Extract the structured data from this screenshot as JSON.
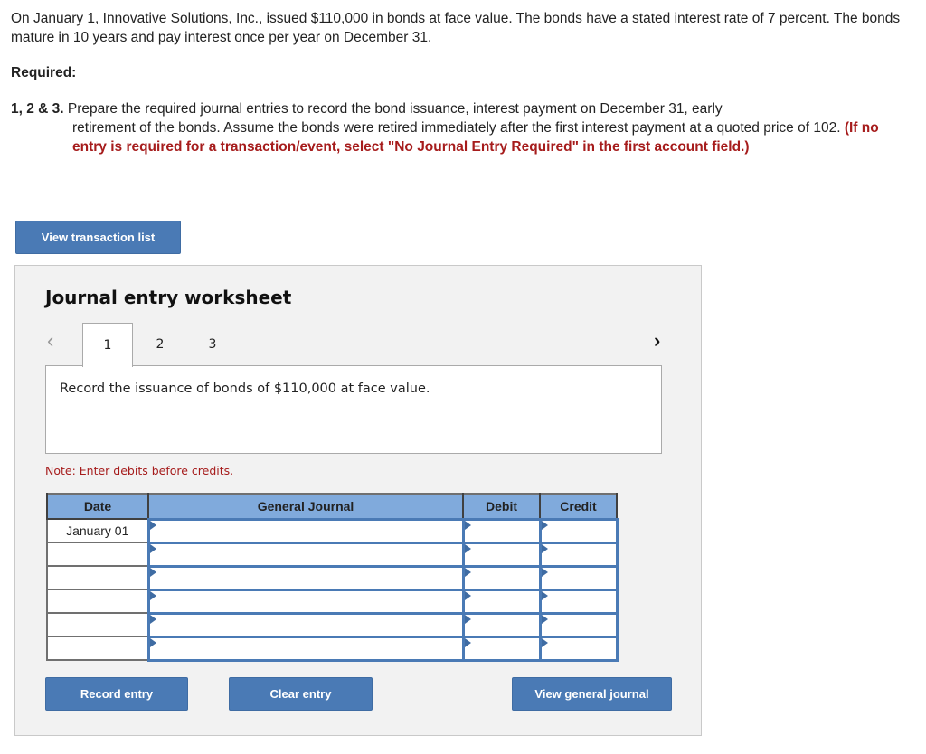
{
  "problem_text": "On January 1, Innovative Solutions, Inc., issued $110,000 in bonds at face value. The bonds have a stated interest rate of 7 percent. The bonds mature in 10 years and pay interest once per year on December 31.",
  "required_label": "Required:",
  "task": {
    "number": "1, 2 & 3.",
    "text_line1": "Prepare the required journal entries to record the bond issuance, interest payment on December 31, early",
    "text_rest": "retirement of the bonds. Assume the bonds were retired immediately after the first interest payment at a quoted price of 102.",
    "instruction": "(If no entry is required for a transaction/event, select \"No Journal Entry Required\" in the first account field.)"
  },
  "buttons": {
    "view_transaction_list": "View transaction list",
    "record_entry": "Record entry",
    "clear_entry": "Clear entry",
    "view_general_journal": "View general journal"
  },
  "worksheet": {
    "title": "Journal entry worksheet",
    "prev_icon": "‹",
    "next_icon": "›",
    "tabs": [
      {
        "label": "1",
        "active": true
      },
      {
        "label": "2",
        "active": false
      },
      {
        "label": "3",
        "active": false
      }
    ],
    "description": "Record the issuance of bonds of $110,000 at face value.",
    "note": "Note: Enter debits before credits."
  },
  "journal": {
    "headers": [
      "Date",
      "General Journal",
      "Debit",
      "Credit"
    ],
    "rows": [
      {
        "date": "January 01",
        "account": "",
        "debit": "",
        "credit": ""
      },
      {
        "date": "",
        "account": "",
        "debit": "",
        "credit": ""
      },
      {
        "date": "",
        "account": "",
        "debit": "",
        "credit": ""
      },
      {
        "date": "",
        "account": "",
        "debit": "",
        "credit": ""
      },
      {
        "date": "",
        "account": "",
        "debit": "",
        "credit": ""
      },
      {
        "date": "",
        "account": "",
        "debit": "",
        "credit": ""
      }
    ]
  },
  "colors": {
    "accent": "#4a7ab5",
    "header_blue": "#80aadc",
    "instruction_red": "#a61c1c",
    "panel_bg": "#f2f2f2"
  }
}
